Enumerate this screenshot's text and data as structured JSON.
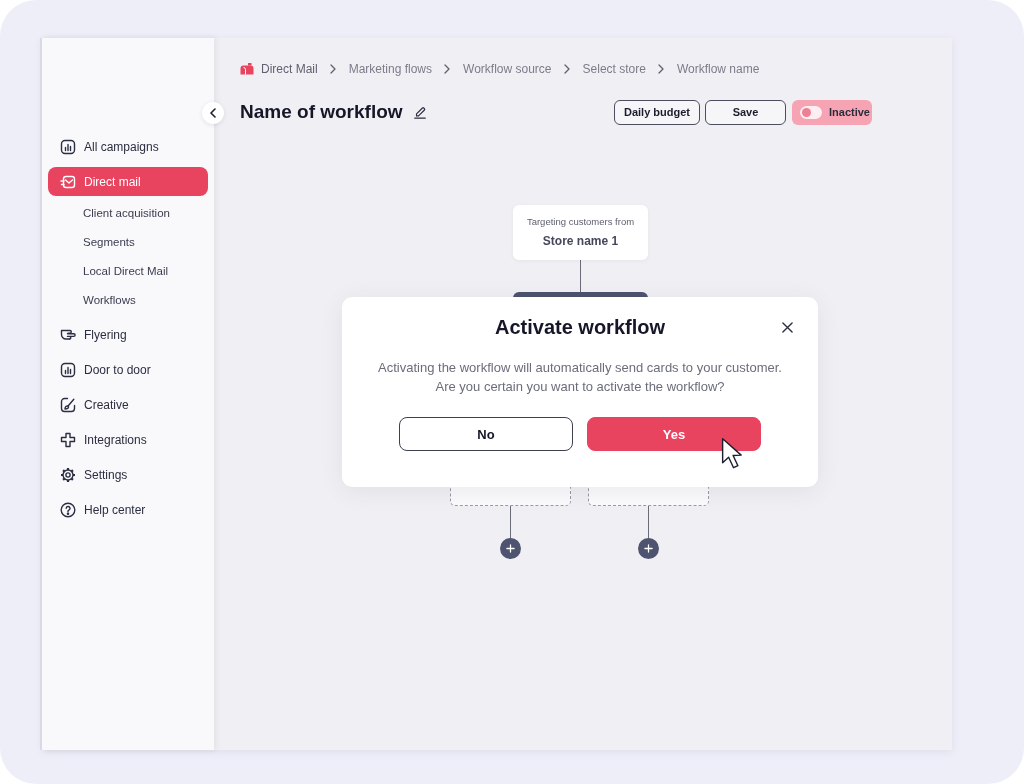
{
  "sidebar": {
    "items": [
      {
        "label": "All campaigns",
        "selected": false
      },
      {
        "label": "Direct mail",
        "selected": true,
        "children": [
          {
            "label": "Client acquisition",
            "selected": false
          },
          {
            "label": "Segments",
            "selected": false
          },
          {
            "label": "Local Direct Mail",
            "selected": false
          },
          {
            "label": "Workflows",
            "selected": false
          }
        ]
      },
      {
        "label": "Flyering",
        "selected": false
      },
      {
        "label": "Door to door",
        "selected": false
      },
      {
        "label": "Creative",
        "selected": false
      },
      {
        "label": "Integrations",
        "selected": false
      },
      {
        "label": "Settings",
        "selected": false
      },
      {
        "label": "Help center",
        "selected": false
      }
    ]
  },
  "breadcrumb": [
    "Direct Mail",
    "Marketing flows",
    "Workflow source",
    "Select store",
    "Workflow name"
  ],
  "header": {
    "title": "Name of workflow",
    "buttons": [
      "Daily budget",
      "Save"
    ],
    "status": {
      "label": "Inactive",
      "on": false
    }
  },
  "flow": {
    "trigger": {
      "caption": "Targeting customers from",
      "store": "Store name 1"
    }
  },
  "dialog": {
    "title": "Activate workflow",
    "message": "Activating the workflow will automatically send cards to your customer.\nAre you certain you want to activate the workflow?",
    "buttons": [
      {
        "label": "No",
        "kind": "secondary"
      },
      {
        "label": "Yes",
        "kind": "primary"
      }
    ]
  }
}
